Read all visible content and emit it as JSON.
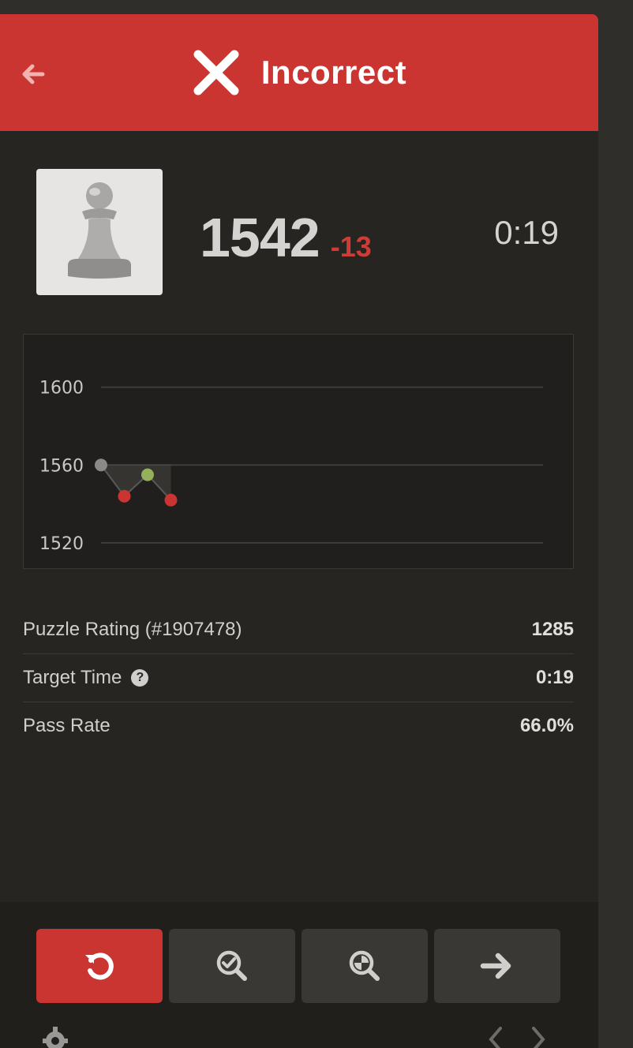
{
  "header": {
    "title": "Incorrect",
    "back_icon": "arrow-left-icon",
    "status_icon": "x-icon",
    "color": "#ca3431"
  },
  "player": {
    "avatar_icon": "pawn-icon",
    "rating": "1542",
    "rating_delta": "-13",
    "timer": "0:19"
  },
  "chart_data": {
    "type": "line",
    "yticks": [
      "1600",
      "1560",
      "1520"
    ],
    "ylim": [
      1507,
      1627
    ],
    "grid": true,
    "points": [
      {
        "x": 0,
        "y": 1560,
        "result": "start"
      },
      {
        "x": 1,
        "y": 1544,
        "result": "fail"
      },
      {
        "x": 2,
        "y": 1555,
        "result": "pass"
      },
      {
        "x": 3,
        "y": 1542,
        "result": "fail"
      }
    ],
    "colors": {
      "start": "#8b8987",
      "fail": "#ca3431",
      "pass": "#95b05a",
      "line": "#5a5856"
    }
  },
  "stats": {
    "puzzle_rating_label": "Puzzle Rating (#1907478)",
    "puzzle_rating_value": "1285",
    "target_time_label": "Target Time",
    "target_time_value": "0:19",
    "pass_rate_label": "Pass Rate",
    "pass_rate_value": "66.0%"
  },
  "footer": {
    "buttons": [
      "retry-icon",
      "analysis-icon",
      "hint-icon",
      "arrow-right-icon"
    ],
    "settings_icon": "gear-icon",
    "nav_icons": [
      "chevron-left-icon",
      "chevron-right-icon"
    ]
  }
}
